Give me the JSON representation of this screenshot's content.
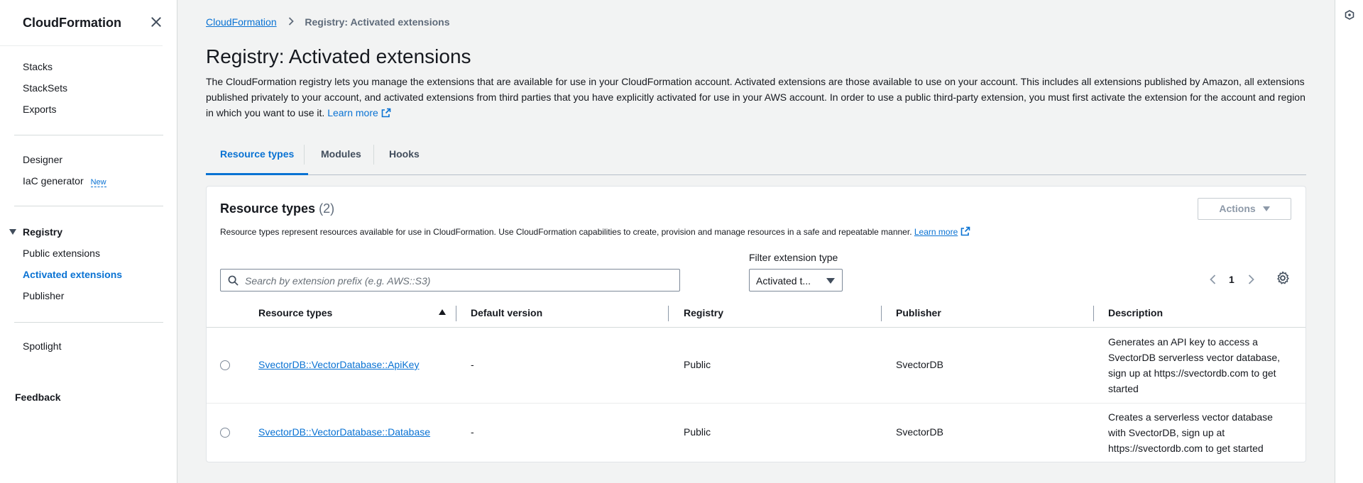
{
  "sidebar": {
    "title": "CloudFormation",
    "items": {
      "stacks": "Stacks",
      "stacksets": "StackSets",
      "exports": "Exports",
      "designer": "Designer",
      "iac_generator": "IaC generator",
      "new_badge": "New",
      "registry_section": "Registry",
      "public_extensions": "Public extensions",
      "activated_extensions": "Activated extensions",
      "publisher": "Publisher",
      "spotlight": "Spotlight",
      "feedback": "Feedback"
    }
  },
  "breadcrumb": {
    "root": "CloudFormation",
    "current": "Registry: Activated extensions"
  },
  "page": {
    "title": "Registry: Activated extensions",
    "description": "The CloudFormation registry lets you manage the extensions that are available for use in your CloudFormation account. Activated extensions are those available to use on your account. This includes all extensions published by Amazon, all extensions published privately to your account, and activated extensions from third parties that you have explicitly activated for use in your AWS account. In order to use a public third-party extension, you must first activate the extension for the account and region in which you want to use it.",
    "learn_more": "Learn more"
  },
  "tabs": [
    "Resource types",
    "Modules",
    "Hooks"
  ],
  "container": {
    "title": "Resource types",
    "count": "(2)",
    "actions_label": "Actions",
    "description": "Resource types represent resources available for use in CloudFormation. Use CloudFormation capabilities to create, provision and manage resources in a safe and repeatable manner.",
    "learn_more": "Learn more",
    "search_placeholder": "Search by extension prefix (e.g. AWS::S3)",
    "filter_label": "Filter extension type",
    "filter_value": "Activated t...",
    "page_number": "1"
  },
  "table": {
    "columns": [
      "Resource types",
      "Default version",
      "Registry",
      "Publisher",
      "Description"
    ],
    "rows": [
      {
        "resource_type": "SvectorDB::VectorDatabase::ApiKey",
        "default_version": "-",
        "registry": "Public",
        "publisher": "SvectorDB",
        "description": "Generates an API key to access a SvectorDB serverless vector database, sign up at https://svectordb.com to get started"
      },
      {
        "resource_type": "SvectorDB::VectorDatabase::Database",
        "default_version": "-",
        "registry": "Public",
        "publisher": "SvectorDB",
        "description": "Creates a serverless vector database with SvectorDB, sign up at https://svectordb.com to get started"
      }
    ]
  },
  "colors": {
    "accent": "#0972d3",
    "background": "#f2f3f3"
  },
  "icons": [
    "close-icon",
    "external-link-icon",
    "search-icon",
    "caret-down-icon",
    "chevron-left-icon",
    "chevron-right-icon",
    "gear-icon",
    "sort-ascending-icon",
    "info-panel-icon"
  ]
}
